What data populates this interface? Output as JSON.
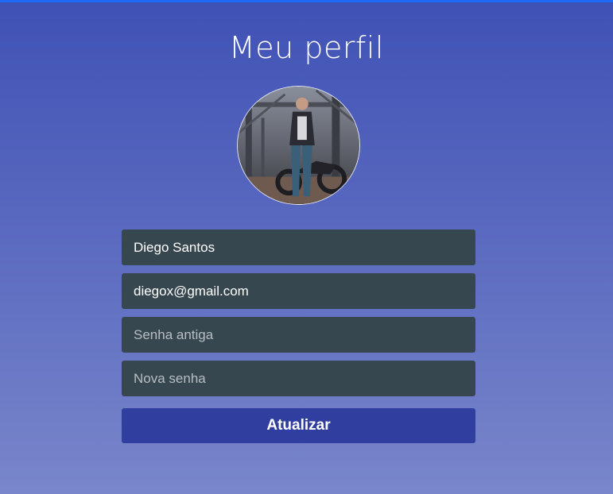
{
  "page": {
    "title": "Meu perfil"
  },
  "avatar": {
    "description_icon": "avatar-photo"
  },
  "form": {
    "name_value": "Diego Santos",
    "email_value": "diegox@gmail.com",
    "old_password_placeholder": "Senha antiga",
    "new_password_placeholder": "Nova senha",
    "submit_label": "Atualizar"
  },
  "colors": {
    "background_top": "#3f51b5",
    "background_bottom": "#7986cb",
    "top_bar": "#1e6aff",
    "input_bg": "#37474f",
    "button_bg": "#303f9f",
    "text": "#ffffff"
  }
}
